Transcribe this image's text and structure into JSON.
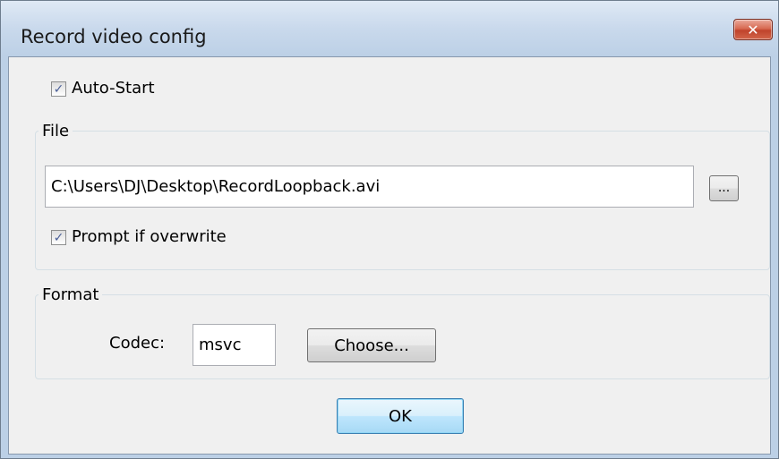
{
  "window": {
    "title": "Record video config",
    "close_glyph": "✕"
  },
  "auto_start": {
    "label": "Auto-Start",
    "checked": true
  },
  "file_group": {
    "title": "File",
    "path_value": "C:\\Users\\DJ\\Desktop\\RecordLoopback.avi",
    "browse_label": "...",
    "prompt_overwrite": {
      "label": "Prompt if overwrite",
      "checked": true
    }
  },
  "format_group": {
    "title": "Format",
    "codec_label": "Codec:",
    "codec_value": "msvc",
    "choose_label": "Choose..."
  },
  "ok_label": "OK",
  "check_glyph": "✓"
}
